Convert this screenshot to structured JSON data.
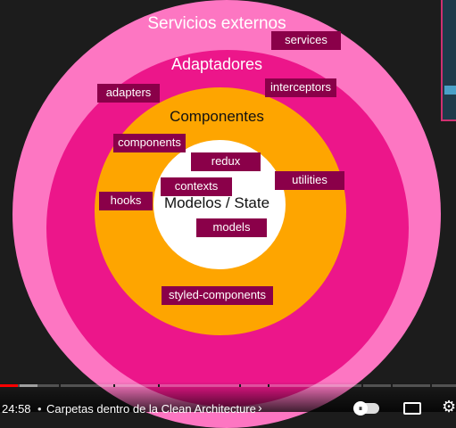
{
  "diagram": {
    "layers": {
      "outer": {
        "title": "Servicios externos",
        "color": "#fd76c2"
      },
      "adapters": {
        "title": "Adaptadores",
        "color": "#ec168a"
      },
      "components": {
        "title": "Componentes",
        "color": "#fea500"
      },
      "core": {
        "title": "Modelos / State",
        "color": "#ffffff"
      }
    },
    "tags": {
      "services": "services",
      "adapters": "adapters",
      "interceptors": "interceptors",
      "components": "components",
      "redux": "redux",
      "contexts": "contexts",
      "utilities": "utilities",
      "hooks": "hooks",
      "models": "models",
      "styled_components": "styled-components"
    },
    "tag_color": "#8a0049"
  },
  "player": {
    "current_time": "24:58",
    "separator": "•",
    "chapter_title": "Carpetas dentro de la Clean Architecture",
    "chapter_chevron": "›",
    "progress_fraction": 0.04,
    "play_glyph": "⏸"
  },
  "icons": {
    "autoplay": "autoplay-toggle-icon",
    "subtitles": "subtitles-icon",
    "settings": "settings-gear-icon"
  }
}
